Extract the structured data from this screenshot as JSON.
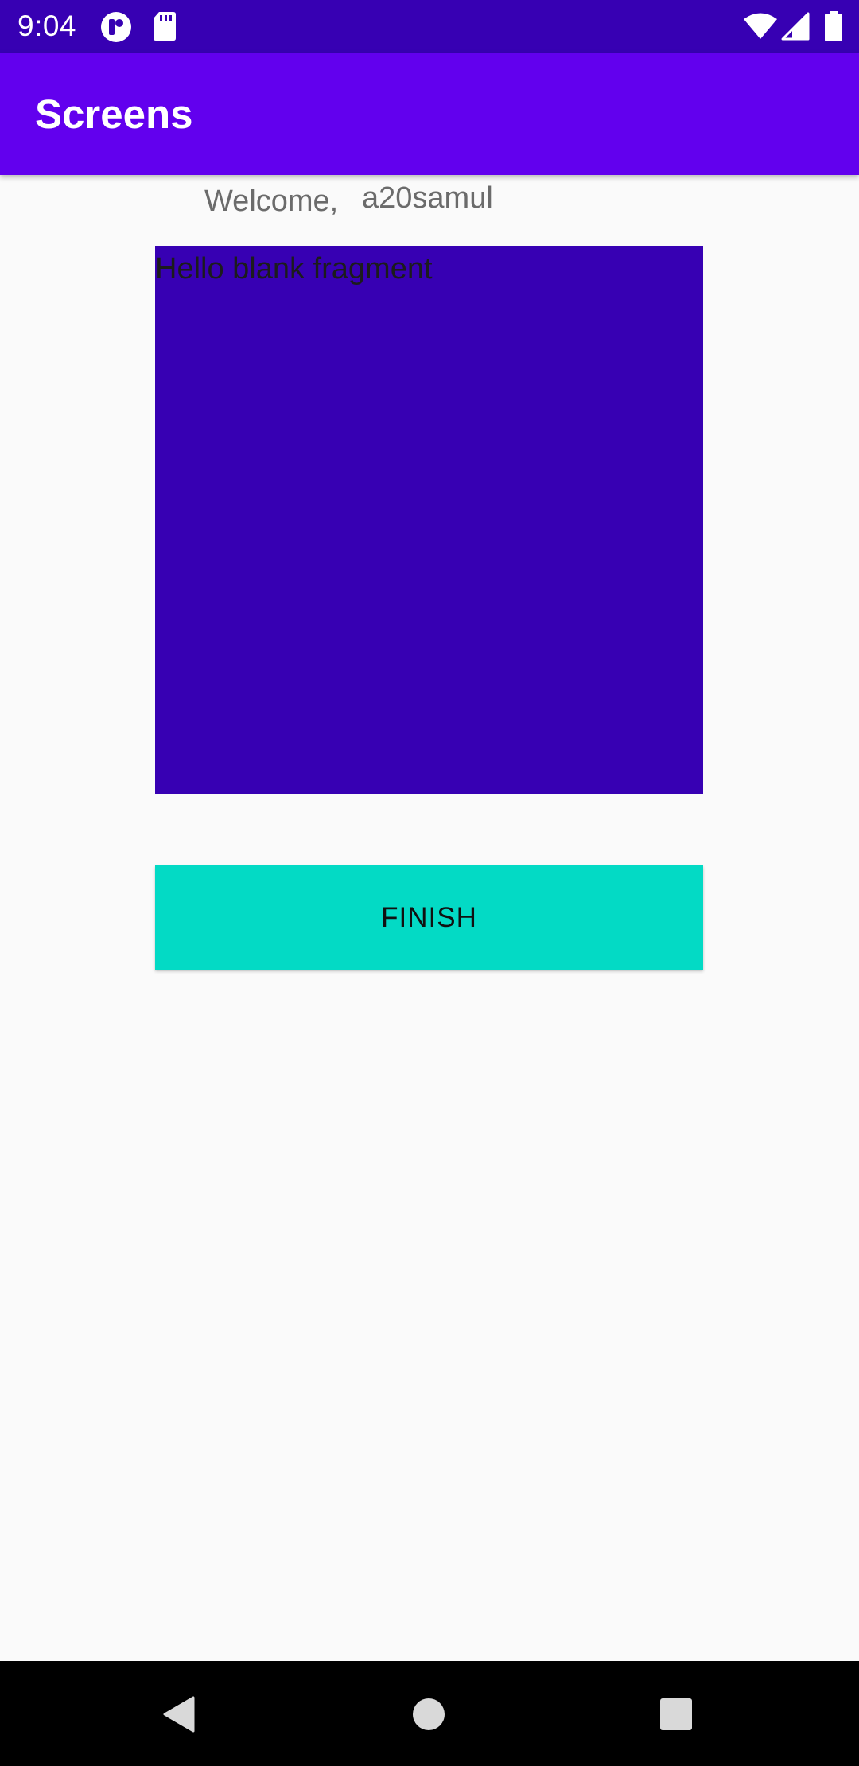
{
  "status_bar": {
    "time": "9:04",
    "icons": [
      "notification-app-icon",
      "sd-card-icon",
      "wifi-icon",
      "signal-icon",
      "battery-icon"
    ]
  },
  "app_bar": {
    "title": "Screens"
  },
  "content": {
    "welcome_label": "Welcome,",
    "username": "a20samul",
    "fragment_text": "Hello blank fragment",
    "finish_button_label": "FINISH"
  },
  "nav_bar": {
    "icons": [
      "back-icon",
      "home-icon",
      "recents-icon"
    ]
  },
  "colors": {
    "status_bar": "#3700b3",
    "app_bar": "#6200ee",
    "fragment_background": "#3700b3",
    "finish_button": "#03dac5",
    "background": "#fafafa",
    "nav_bar": "#000000"
  }
}
